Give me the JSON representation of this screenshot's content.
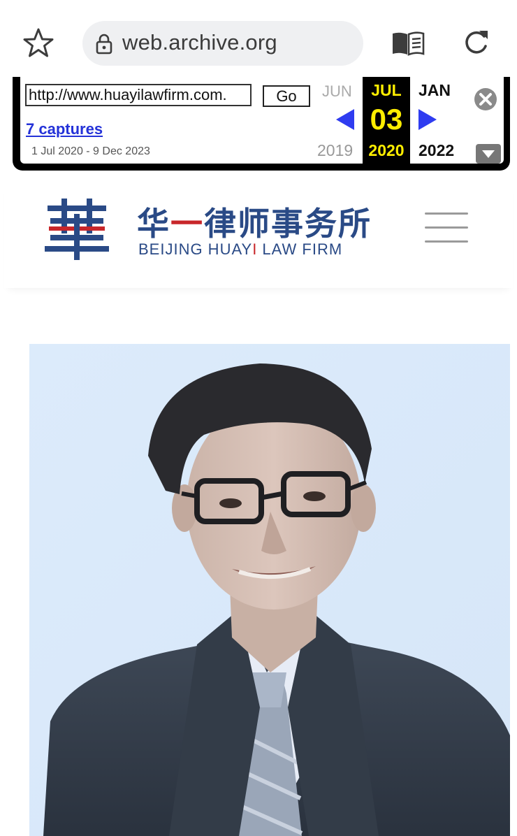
{
  "browser": {
    "url_display": "web.archive.org",
    "icons": [
      "star-icon",
      "lock-icon",
      "reader-mode-icon",
      "reload-icon"
    ]
  },
  "wayback": {
    "url_input_value": "http://www.huayilawfirm.com.",
    "go_label": "Go",
    "captures_label": "7 captures",
    "date_range": "1 Jul 2020 - 9 Dec 2023",
    "prev": {
      "month": "JUN",
      "year": "2019"
    },
    "current": {
      "month": "JUL",
      "day": "03",
      "year": "2020"
    },
    "next": {
      "month": "JAN",
      "year": "2022"
    },
    "colors": {
      "highlight": "#ffee00",
      "arrow": "#2f3cf0",
      "link": "#2432d8"
    }
  },
  "site": {
    "brand_cn_part1": "华",
    "brand_cn_dash": "一",
    "brand_cn_part2": "律师事务所",
    "brand_en_part1": "BEIJING HUAY",
    "brand_en_red": "I",
    "brand_en_part2": " LAW FIRM",
    "logo_glyph": "華",
    "colors": {
      "navy": "#2a4a86",
      "red": "#c8262a",
      "portrait_bg": "#dbeafb"
    }
  }
}
